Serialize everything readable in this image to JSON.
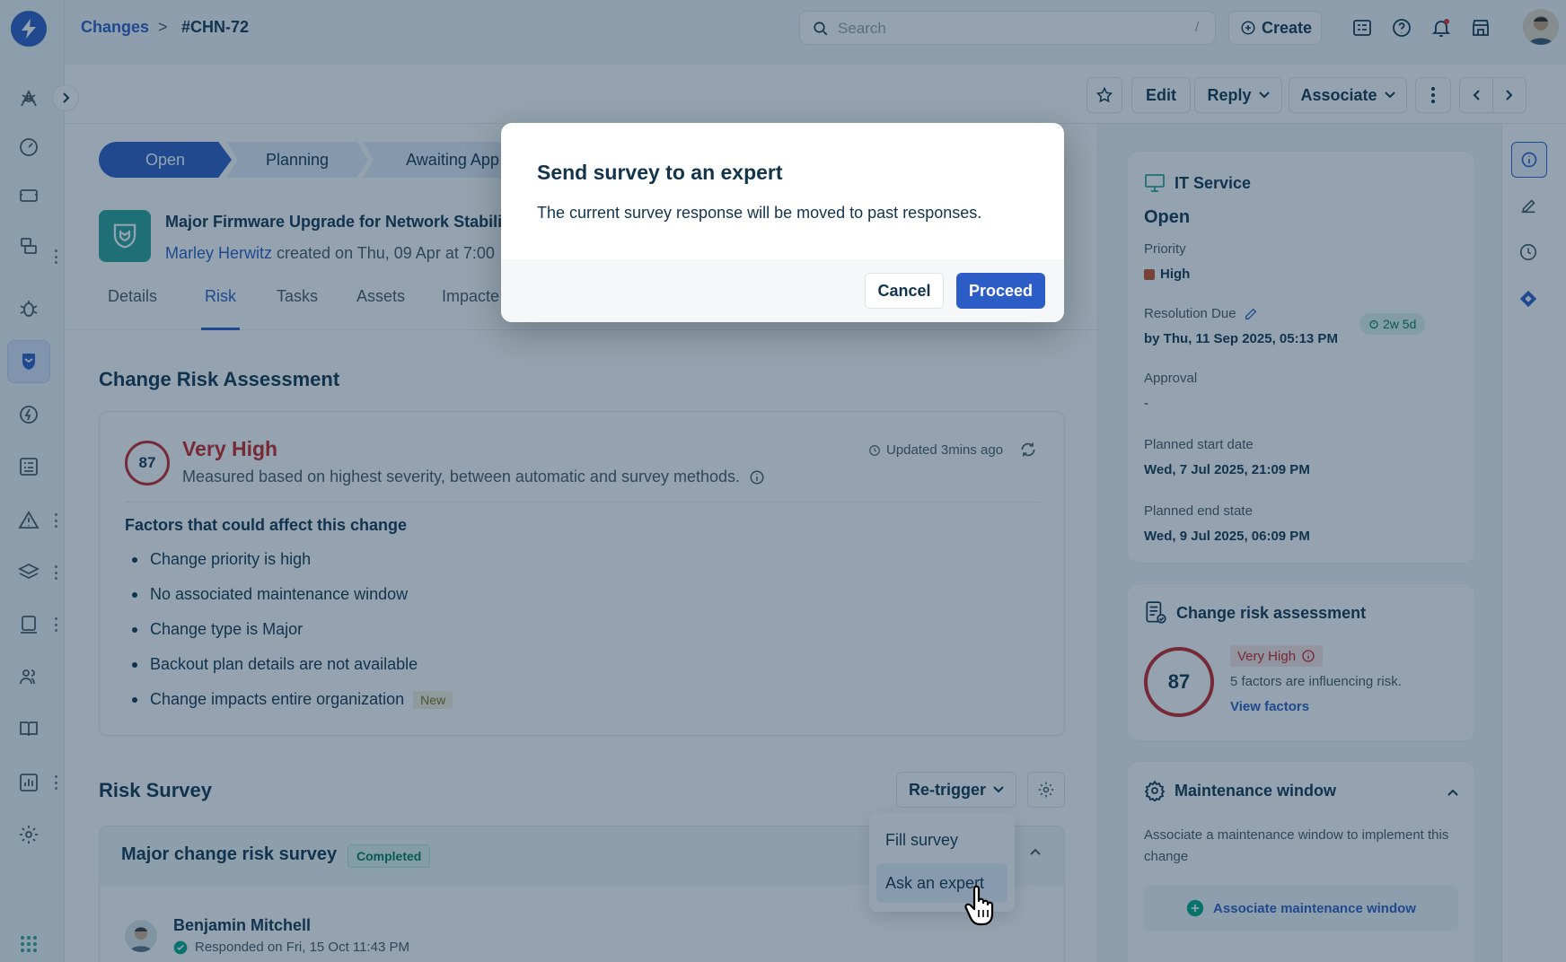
{
  "header": {
    "breadcrumb_root": "Changes",
    "breadcrumb_sep": ">",
    "breadcrumb_current": "#CHN-72",
    "search_placeholder": "Search",
    "search_shortcut": "/",
    "create_label": "Create"
  },
  "actions": {
    "edit": "Edit",
    "reply": "Reply",
    "associate": "Associate"
  },
  "stages": [
    "Open",
    "Planning",
    "Awaiting App"
  ],
  "ticket": {
    "title": "Major Firmware Upgrade for Network Stability",
    "requester": "Marley Herwitz",
    "created_text": " created on Thu, 09 Apr at 7:00"
  },
  "tabs": [
    "Details",
    "Risk",
    "Tasks",
    "Assets",
    "Impacte"
  ],
  "risk_assessment": {
    "heading": "Change Risk Assessment",
    "score": "87",
    "level": "Very High",
    "description": "Measured based on highest severity, between automatic and survey methods.",
    "updated": "Updated 3mins ago",
    "factors_heading": "Factors that could affect this change",
    "factors": [
      "Change priority is high",
      "No associated maintenance window",
      "Change type is Major",
      "Backout plan details are not available",
      "Change impacts entire organization"
    ],
    "new_badge": "New"
  },
  "risk_survey": {
    "heading": "Risk Survey",
    "retrigger_label": "Re-trigger",
    "dropdown_items": [
      "Fill survey",
      "Ask an expert"
    ],
    "survey_title": "Major change risk survey",
    "survey_status": "Completed",
    "responder": "Benjamin Mitchell",
    "responded_text": "Responded on Fri, 15 Oct 11:43 PM"
  },
  "right_panel": {
    "service": "IT Service",
    "status": "Open",
    "priority_label": "Priority",
    "priority_value": "High",
    "resolution_label": "Resolution Due",
    "resolution_value": "by Thu, 11 Sep 2025, 05:13 PM",
    "resolution_badge": "2w 5d",
    "approval_label": "Approval",
    "approval_value": "-",
    "start_label": "Planned start date",
    "start_value": "Wed, 7 Jul 2025, 21:09 PM",
    "end_label": "Planned end state",
    "end_value": "Wed, 9 Jul 2025, 06:09 PM",
    "cra_title": "Change risk assessment",
    "cra_score": "87",
    "cra_level": "Very High",
    "cra_text": "5 factors are influencing risk.",
    "cra_link": "View factors",
    "mw_title": "Maintenance window",
    "mw_text": "Associate a maintenance window to implement this change",
    "mw_button": "Associate maintenance window"
  },
  "modal": {
    "title": "Send survey to an expert",
    "body": "The current survey response will be moved to past responses.",
    "cancel": "Cancel",
    "proceed": "Proceed"
  },
  "colors": {
    "accent": "#2c5cc5",
    "danger": "#c82124",
    "success": "#2ba398",
    "priority_high": "#c7502a"
  }
}
